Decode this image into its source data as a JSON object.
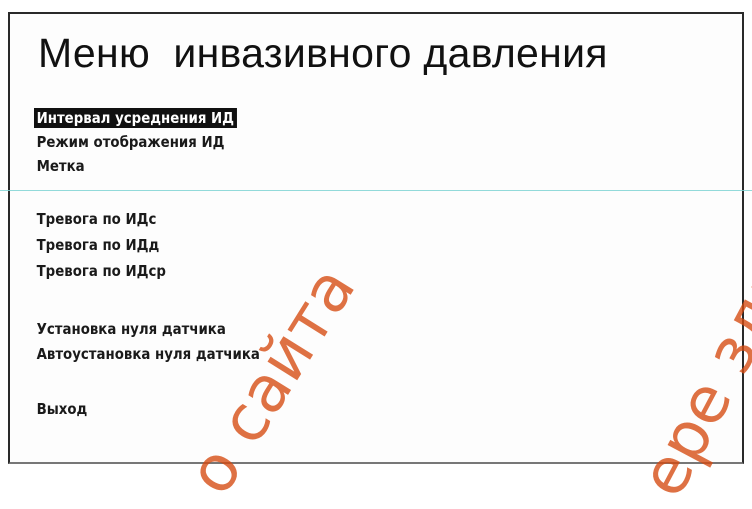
{
  "screen": {
    "title": "Меню  инвазивного давления"
  },
  "menu": {
    "items": [
      {
        "label": "Интервал усреднения ИД",
        "selected": true
      },
      {
        "label": "Режим отображения ИД",
        "selected": false
      },
      {
        "label": "Метка",
        "selected": false
      },
      {
        "label": "Тревога по ИДс",
        "selected": false
      },
      {
        "label": "Тревога по ИДд",
        "selected": false
      },
      {
        "label": "Тревога по ИДср",
        "selected": false
      },
      {
        "label": "Установка нуля датчика",
        "selected": false
      },
      {
        "label": "Автоустановка нуля датчика",
        "selected": false
      },
      {
        "label": "Выход",
        "selected": false
      }
    ]
  },
  "watermark": {
    "left_text": "о сайта",
    "right_text": "ере здравоох"
  },
  "colors": {
    "selection_bg": "#111111",
    "selection_fg": "#ffffff",
    "watermark": "#d64a10"
  }
}
